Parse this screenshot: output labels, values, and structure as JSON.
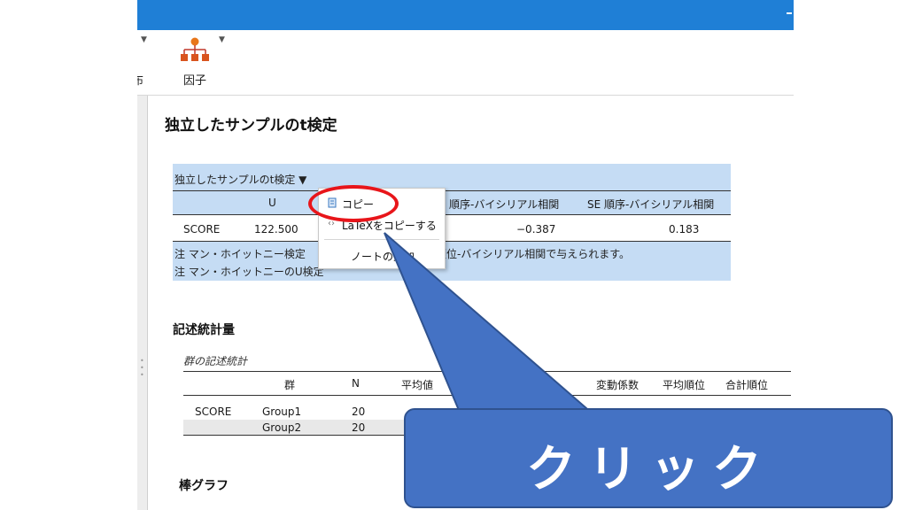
{
  "ribbon": {
    "left_label_fragment": "布",
    "factor_label": "因子",
    "factor_icon": "factor-hierarchy-icon"
  },
  "results": {
    "title": "独立したサンプルのt検定",
    "ttest_table": {
      "caption": "独立したサンプルのt検定 ▼",
      "columns": [
        "U",
        "順序-バイシリアル相関",
        "SE 順序-バイシリアル相関"
      ],
      "row": {
        "label": "SCORE",
        "u": "122.500",
        "rank_biserial": "−0.387",
        "se_rank_biserial": "0.183"
      },
      "note1_prefix": "注 マン・ホイットニー検定",
      "note1_suffix": "順位-バイシリアル相関で与えられます。",
      "note2": "注 マン・ホイットニーのU検定"
    },
    "context_menu": {
      "items": [
        {
          "label": "コピー",
          "icon": "copy-icon"
        },
        {
          "label": "LaTeXをコピーする",
          "icon": "latex-icon"
        },
        {
          "label": "ノートの追加",
          "icon": ""
        }
      ]
    },
    "descriptives": {
      "title": "記述統計量",
      "caption": "群の記述統計",
      "columns": [
        "群",
        "N",
        "平均値",
        "標",
        "変動係数",
        "平均順位",
        "合計順位"
      ],
      "rows": [
        {
          "var": "SCORE",
          "group": "Group1",
          "n": "20"
        },
        {
          "var": "",
          "group": "Group2",
          "n": "20"
        }
      ]
    },
    "bar_chart_title": "棒グラフ"
  },
  "callout": {
    "text": "クリック",
    "color": "#4472c4"
  },
  "colors": {
    "titlebar": "#1f7fd6",
    "table_highlight": "#c5dcf4",
    "ring": "#e8151a"
  }
}
